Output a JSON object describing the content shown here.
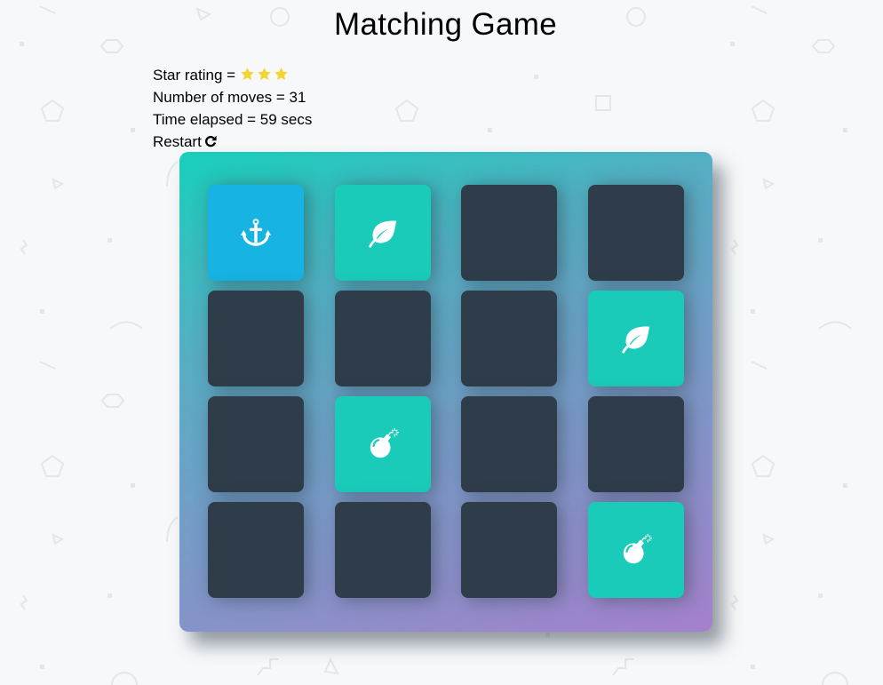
{
  "page": {
    "title": "Matching Game"
  },
  "score_panel": {
    "star_label": "Star rating = ",
    "stars_count": 3,
    "star_color": "#f5d431",
    "moves_label": "Number of moves = 31",
    "time_label": "Time elapsed = 59 secs",
    "restart_label": "Restart",
    "restart_icon": "refresh-icon"
  },
  "deck": {
    "colors": {
      "closed": "#2e3d49",
      "open": "#17b3e2",
      "match": "#1acbb9"
    },
    "cards": [
      {
        "state": "open",
        "icon": "anchor-icon"
      },
      {
        "state": "match",
        "icon": "leaf-icon"
      },
      {
        "state": "closed",
        "icon": ""
      },
      {
        "state": "closed",
        "icon": ""
      },
      {
        "state": "closed",
        "icon": ""
      },
      {
        "state": "closed",
        "icon": ""
      },
      {
        "state": "closed",
        "icon": ""
      },
      {
        "state": "match",
        "icon": "leaf-icon"
      },
      {
        "state": "closed",
        "icon": ""
      },
      {
        "state": "match",
        "icon": "bomb-icon"
      },
      {
        "state": "closed",
        "icon": ""
      },
      {
        "state": "closed",
        "icon": ""
      },
      {
        "state": "closed",
        "icon": ""
      },
      {
        "state": "closed",
        "icon": ""
      },
      {
        "state": "closed",
        "icon": ""
      },
      {
        "state": "match",
        "icon": "bomb-icon"
      }
    ]
  }
}
